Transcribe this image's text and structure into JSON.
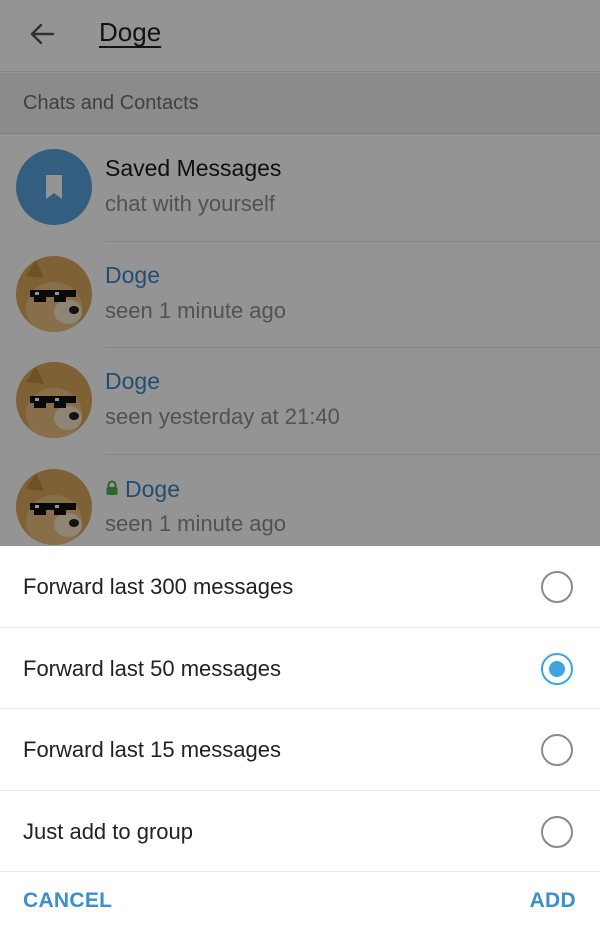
{
  "header": {
    "title": "Doge"
  },
  "section": {
    "title": "Chats and Contacts"
  },
  "chats": [
    {
      "name": "Saved Messages",
      "status": "chat with yourself",
      "avatar": "bookmark-icon"
    },
    {
      "name": "Doge",
      "status": "seen 1 minute ago",
      "avatar": "doge-avatar"
    },
    {
      "name": "Doge",
      "status": "seen yesterday at 21:40",
      "avatar": "doge-avatar"
    },
    {
      "name": "Doge",
      "status": "seen 1 minute ago",
      "avatar": "doge-avatar",
      "secret": true,
      "secret_icon": "lock-icon"
    }
  ],
  "sheet": {
    "options": [
      {
        "label": "Forward last 300 messages",
        "selected": false
      },
      {
        "label": "Forward last 50 messages",
        "selected": true
      },
      {
        "label": "Forward last 15 messages",
        "selected": false
      },
      {
        "label": "Just add to group",
        "selected": false
      }
    ],
    "cancel_label": "CANCEL",
    "add_label": "ADD"
  },
  "colors": {
    "accent": "#3aa6dd",
    "name_blue": "#3b86c4",
    "saved_avatar": "#5ba3db",
    "secret_green": "#4caf50",
    "action_text": "#3a8fcf"
  }
}
